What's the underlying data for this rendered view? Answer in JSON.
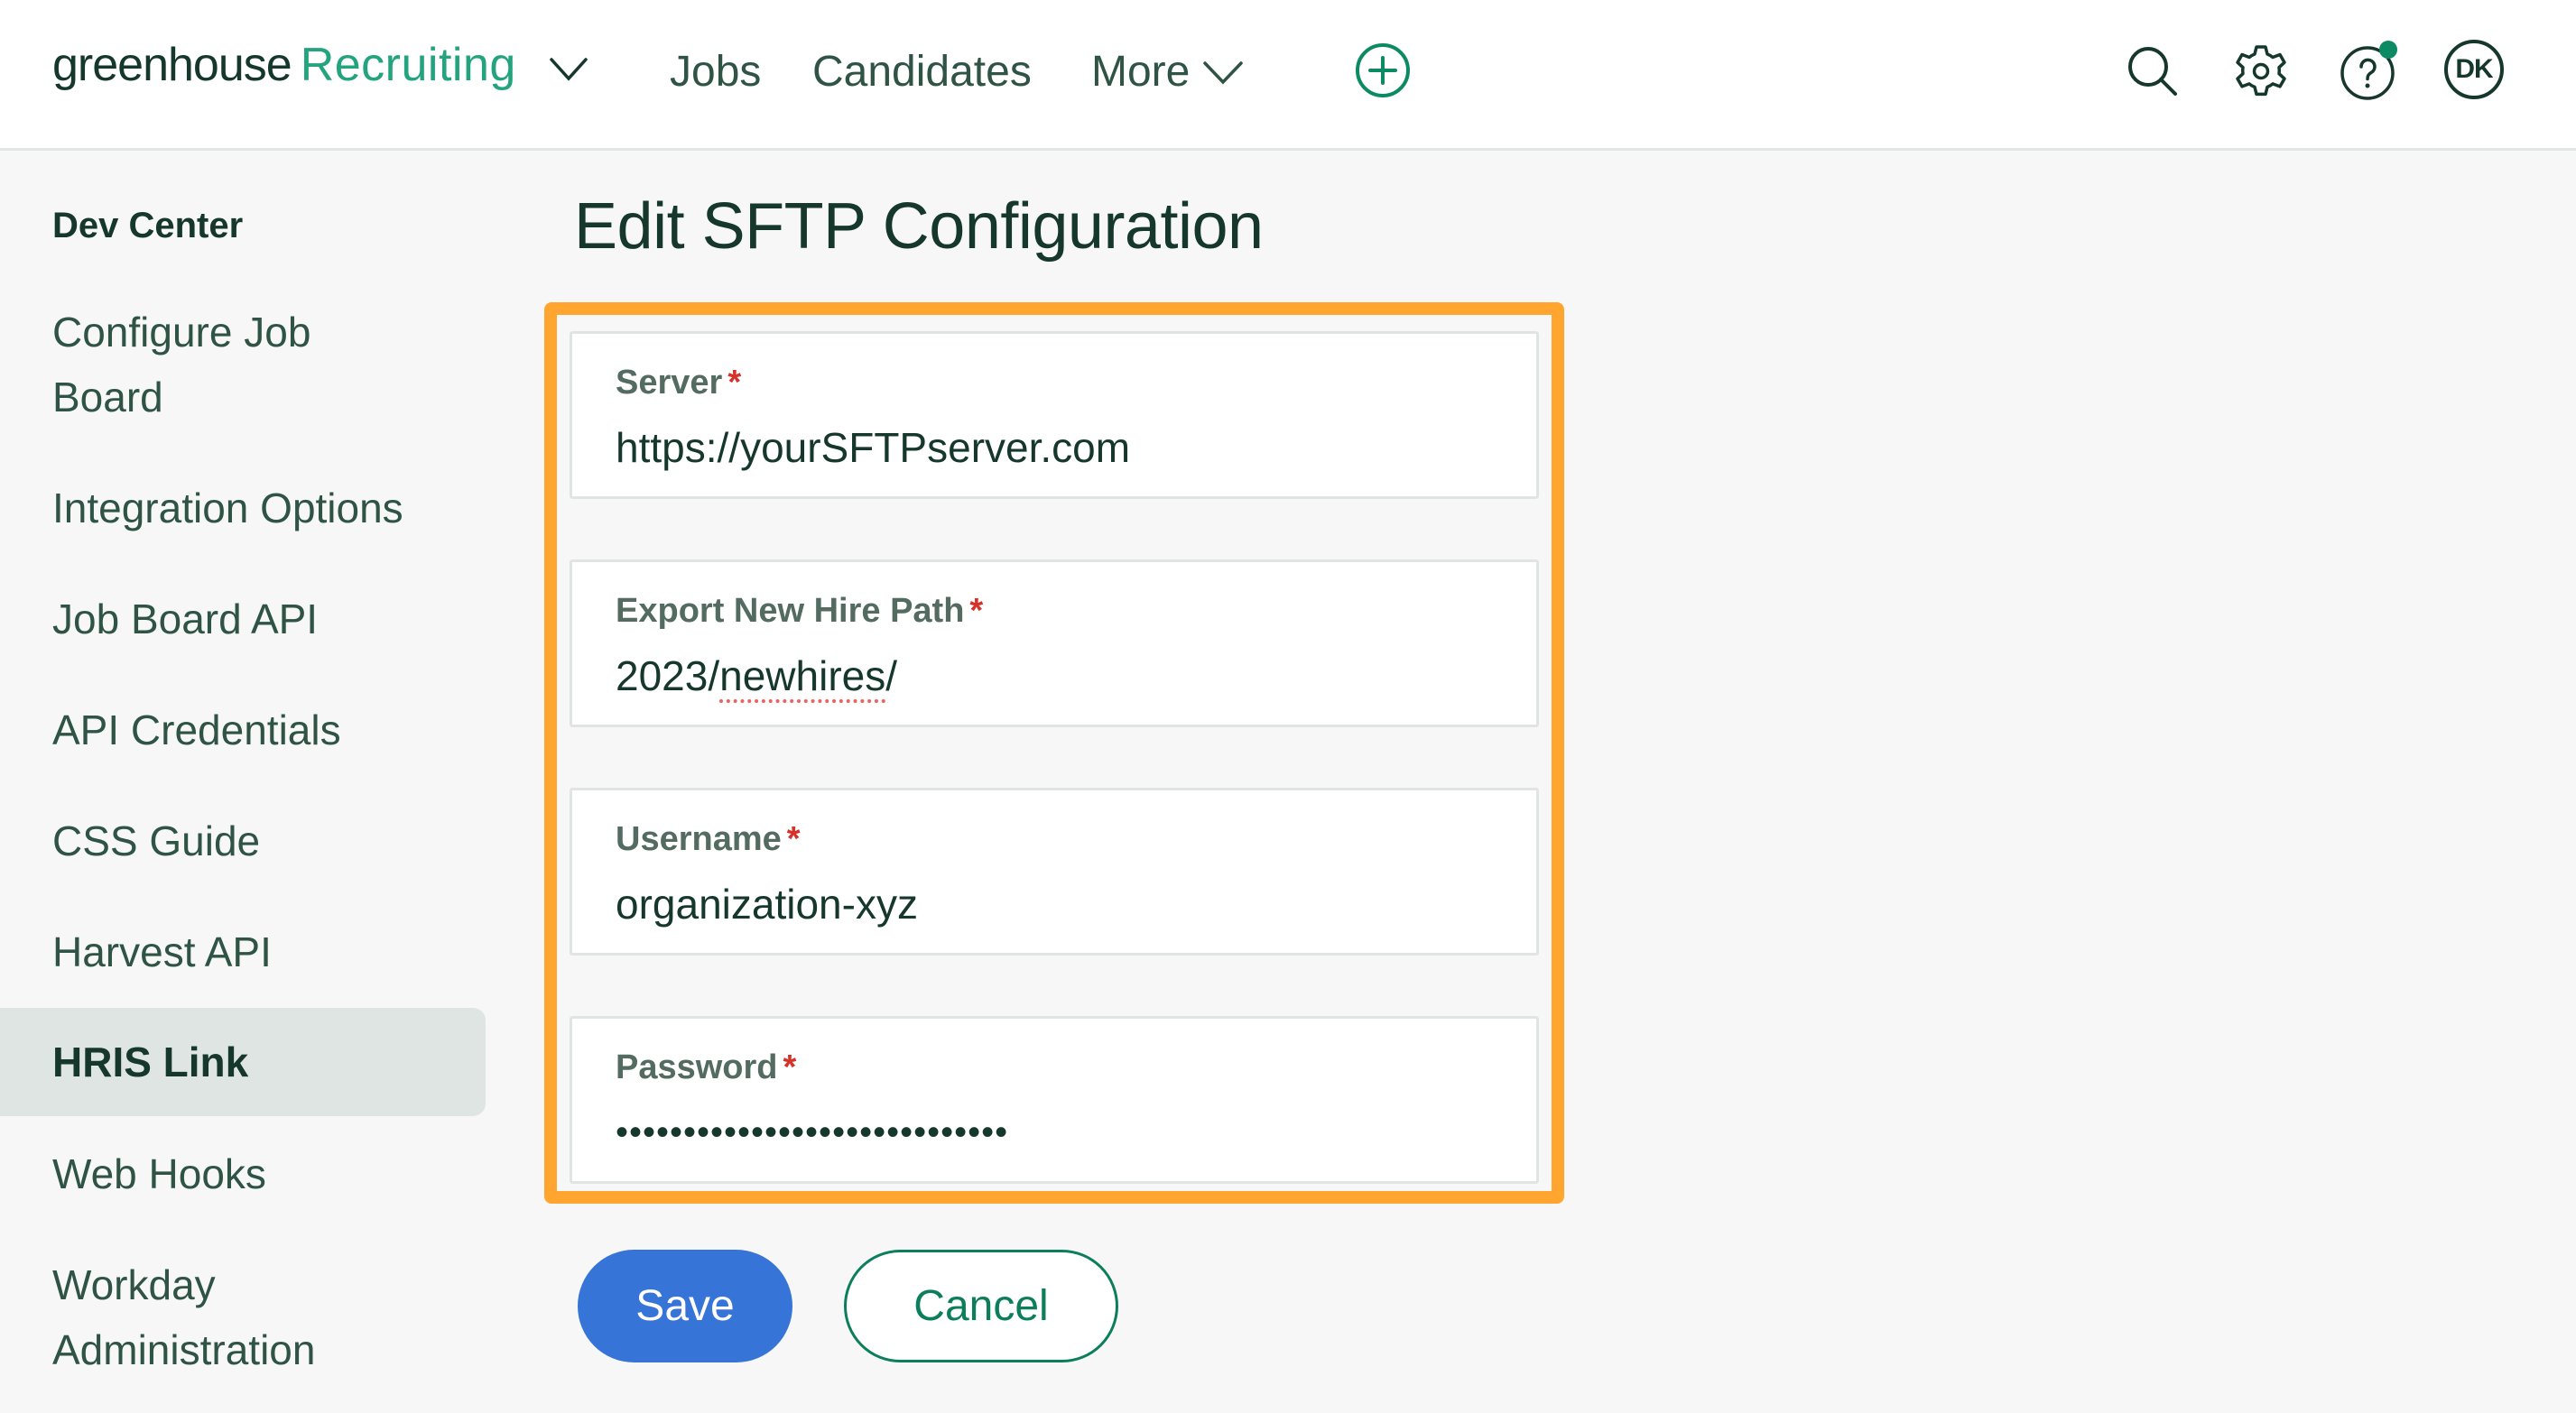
{
  "header": {
    "brand": "greenhouse",
    "product": "Recruiting",
    "nav": [
      {
        "label": "Jobs"
      },
      {
        "label": "Candidates"
      },
      {
        "label": "More"
      }
    ],
    "icons": [
      "add-icon",
      "search-icon",
      "gear-icon",
      "help-icon"
    ],
    "avatar_initials": "DK",
    "notification_dot_color": "#0c8a63"
  },
  "sidebar": {
    "heading": "Dev Center",
    "items": [
      {
        "label_lines": [
          "Configure Job",
          "Board"
        ],
        "active": false
      },
      {
        "label": "Integration Options",
        "active": false
      },
      {
        "label": "Job Board API",
        "active": false
      },
      {
        "label": "API Credentials",
        "active": false
      },
      {
        "label": "CSS Guide",
        "active": false
      },
      {
        "label": "Harvest API",
        "active": false
      },
      {
        "label": "HRIS Link",
        "active": true
      },
      {
        "label": "Web Hooks",
        "active": false
      },
      {
        "label_lines": [
          "Workday",
          "Administration"
        ],
        "active": false
      }
    ]
  },
  "main": {
    "title": "Edit SFTP Configuration",
    "fields": [
      {
        "label": "Server",
        "required_mark": "*",
        "value": "https://yourSFTPserver.com",
        "type": "text"
      },
      {
        "label": "Export New Hire Path",
        "required_mark": "*",
        "value_prefix": "2023/",
        "value_misspelled": "newhires",
        "value_suffix": "/",
        "value": "2023/newhires/",
        "type": "text"
      },
      {
        "label": "Username",
        "required_mark": "*",
        "value": "organization-xyz",
        "type": "text"
      },
      {
        "label": "Password",
        "required_mark": "*",
        "masked_value": "•••••••••••••••••••••••••••••",
        "masked_length": 29,
        "type": "password"
      }
    ],
    "buttons": {
      "save": "Save",
      "cancel": "Cancel"
    }
  },
  "colors": {
    "brand_dark": "#15372c",
    "brand_green": "#23a47f",
    "accent_green": "#0c7e5c",
    "primary_blue": "#3774d8",
    "highlight_orange": "#ffa530",
    "required_red": "#d6322a"
  }
}
